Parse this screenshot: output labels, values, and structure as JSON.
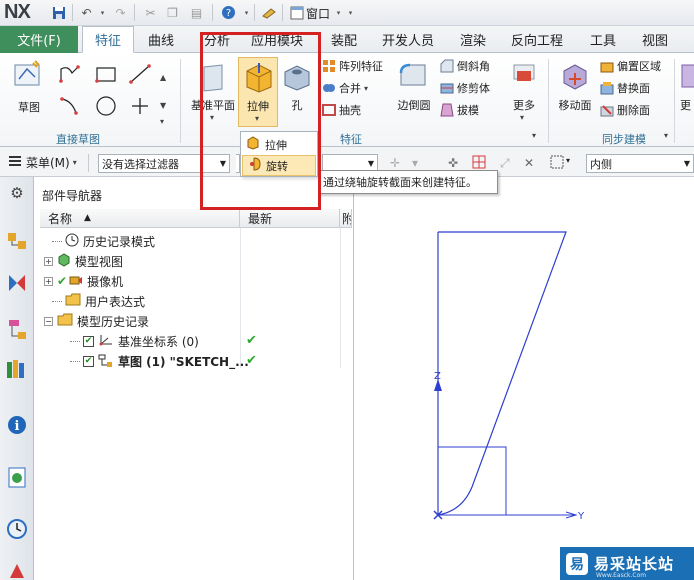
{
  "app": {
    "logo": "NX",
    "window_menu": "窗口"
  },
  "tabs": {
    "file": "文件(F)",
    "items": [
      "特征",
      "曲线",
      "分析",
      "应用模块",
      "装配",
      "开发人员",
      "渲染",
      "反向工程",
      "工具",
      "视图"
    ],
    "active": "特征"
  },
  "ribbon": {
    "groups": {
      "direct_sketch": "直接草图",
      "feature": "特征",
      "sync_modeling": "同步建模"
    },
    "buttons": {
      "sketch": "草图",
      "datum_plane": "基准平面",
      "extrude": "拉伸",
      "hole": "孔",
      "pattern_feature": "阵列特征",
      "unite": "合并",
      "shell": "抽壳",
      "edge_blend": "边倒圆",
      "chamfer": "倒斜角",
      "trim_body": "修剪体",
      "draft": "拔模",
      "more": "更多",
      "move_face": "移动面",
      "offset_region": "偏置区域",
      "replace_face": "替换面",
      "delete_face": "删除面",
      "more2": "更"
    }
  },
  "dropdown": {
    "items": [
      "拉伸",
      "旋转"
    ],
    "highlighted": "旋转",
    "tooltip": "通过绕轴旋转截面来创建特征。"
  },
  "filterbar": {
    "menu": "菜单(M)",
    "filter": "没有选择过滤器",
    "inner": "内侧"
  },
  "navigator": {
    "title": "部件导航器",
    "col_name": "名称",
    "col_latest": "最新",
    "col_extra": "附",
    "rows": [
      {
        "label": "历史记录模式"
      },
      {
        "label": "模型视图"
      },
      {
        "label": "摄像机"
      },
      {
        "label": "用户表达式"
      },
      {
        "label": "模型历史记录"
      },
      {
        "label": "基准坐标系 (0)"
      },
      {
        "label": "草图 (1) \"SKETCH_..."
      }
    ]
  },
  "graphics": {
    "axis_z": "Z",
    "axis_y": "Y"
  },
  "watermark": {
    "logo": "易",
    "text": "易采站长站",
    "sub": "Www.Easck.Com"
  },
  "colors": {
    "file_tab": "#3f8f5c",
    "highlight_box": "#d42222",
    "sketch_line": "#2f3fd0",
    "tab_active_text": "#2f6f95"
  }
}
